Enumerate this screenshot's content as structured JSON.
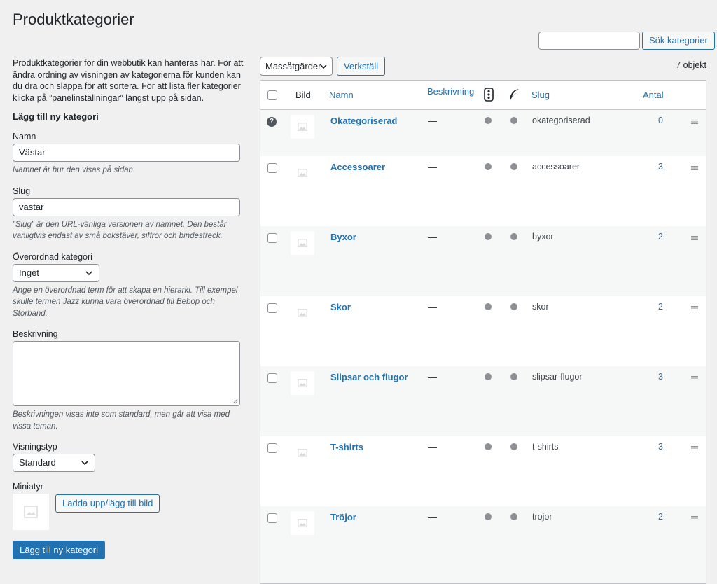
{
  "page": {
    "title": "Produktkategorier"
  },
  "search": {
    "button_label": "Sök kategorier",
    "value": ""
  },
  "intro": "Produktkategorier för din webbutik kan hanteras här. För att ändra ordning av visningen av kategorierna för kunden kan du dra och släppa för att sortera. För att lista fler kategorier klicka på ”panelinställningar” längst upp på sidan.",
  "form": {
    "heading": "Lägg till ny kategori",
    "name": {
      "label": "Namn",
      "value": "Västar",
      "help": "Namnet är hur den visas på sidan."
    },
    "slug": {
      "label": "Slug",
      "value": "vastar",
      "help": "”Slug” är den URL-vänliga versionen av namnet. Den består vanligtvis endast av små bokstäver, siffror och bindestreck."
    },
    "parent": {
      "label": "Överordnad kategori",
      "value": "Inget",
      "help": "Ange en överordnad term för att skapa en hierarki. Till exempel skulle termen Jazz kunna vara överordnad till Bebop och Storband."
    },
    "description": {
      "label": "Beskrivning",
      "value": "",
      "help": "Beskrivningen visas inte som standard, men går att visa med vissa teman."
    },
    "display_type": {
      "label": "Visningstyp",
      "value": "Standard"
    },
    "thumbnail": {
      "label": "Miniatyr",
      "upload_label": "Ladda upp/lägg till bild"
    },
    "submit_label": "Lägg till ny kategori"
  },
  "bulk": {
    "select_label": "Massåtgärder",
    "apply_label": "Verkställ",
    "count_label": "7 objekt"
  },
  "table": {
    "headers": {
      "image": "Bild",
      "name": "Namn",
      "description": "Beskrivning",
      "slug": "Slug",
      "count": "Antal"
    },
    "rows": [
      {
        "name": "Okategoriserad",
        "description": "—",
        "slug": "okategoriserad",
        "count": "0",
        "default": true
      },
      {
        "name": "Accessoarer",
        "description": "—",
        "slug": "accessoarer",
        "count": "3",
        "default": false
      },
      {
        "name": "Byxor",
        "description": "—",
        "slug": "byxor",
        "count": "2",
        "default": false
      },
      {
        "name": "Skor",
        "description": "—",
        "slug": "skor",
        "count": "2",
        "default": false
      },
      {
        "name": "Slipsar och flugor",
        "description": "—",
        "slug": "slipsar-flugor",
        "count": "3",
        "default": false
      },
      {
        "name": "T-shirts",
        "description": "—",
        "slug": "t-shirts",
        "count": "3",
        "default": false
      },
      {
        "name": "Tröjor",
        "description": "—",
        "slug": "trojor",
        "count": "2",
        "default": false
      }
    ]
  },
  "colors": {
    "accent": "#2271b1",
    "background": "#f0f0f1",
    "border": "#c3c4c7",
    "status_dot": "#8c8f94"
  },
  "icons": {
    "help": "help-icon",
    "traffic_light": "traffic-light-icon",
    "feather": "feather-icon",
    "handle": "drag-handle-icon",
    "image": "image-placeholder-icon",
    "chevron": "chevron-down-icon"
  }
}
